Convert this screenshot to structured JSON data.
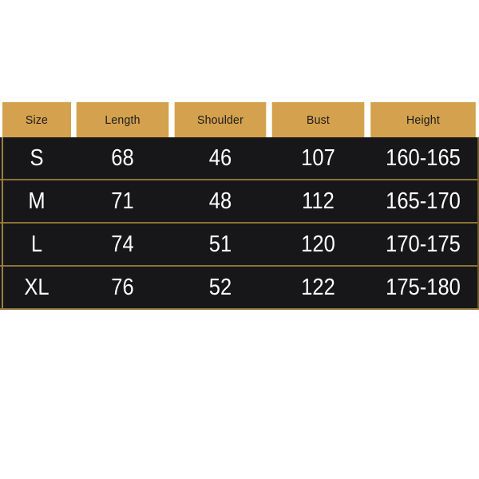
{
  "colors": {
    "header_bg": "#d4a14e",
    "header_text": "#1b1b1b",
    "row_bg": "#17171a",
    "row_text": "#ffffff",
    "divider": "#8d7238",
    "page_bg": "#ffffff"
  },
  "size_chart": {
    "columns": [
      {
        "key": "size",
        "label": "Size"
      },
      {
        "key": "length",
        "label": "Length"
      },
      {
        "key": "shoulder",
        "label": "Shoulder"
      },
      {
        "key": "bust",
        "label": "Bust"
      },
      {
        "key": "height",
        "label": "Height"
      }
    ],
    "rows": [
      {
        "size": "S",
        "length": "68",
        "shoulder": "46",
        "bust": "107",
        "height": "160-165"
      },
      {
        "size": "M",
        "length": "71",
        "shoulder": "48",
        "bust": "112",
        "height": "165-170"
      },
      {
        "size": "L",
        "length": "74",
        "shoulder": "51",
        "bust": "120",
        "height": "170-175"
      },
      {
        "size": "XL",
        "length": "76",
        "shoulder": "52",
        "bust": "122",
        "height": "175-180"
      }
    ]
  },
  "chart_data": {
    "type": "table",
    "title": "",
    "categories": [
      "S",
      "M",
      "L",
      "XL"
    ],
    "columns": [
      "Size",
      "Length",
      "Shoulder",
      "Bust",
      "Height"
    ],
    "series": [
      {
        "name": "Length",
        "values": [
          68,
          71,
          74,
          76
        ]
      },
      {
        "name": "Shoulder",
        "values": [
          46,
          48,
          51,
          52
        ]
      },
      {
        "name": "Bust",
        "values": [
          107,
          112,
          120,
          122
        ]
      },
      {
        "name": "Height",
        "values": [
          "160-165",
          "165-170",
          "170-175",
          "175-180"
        ]
      }
    ]
  }
}
